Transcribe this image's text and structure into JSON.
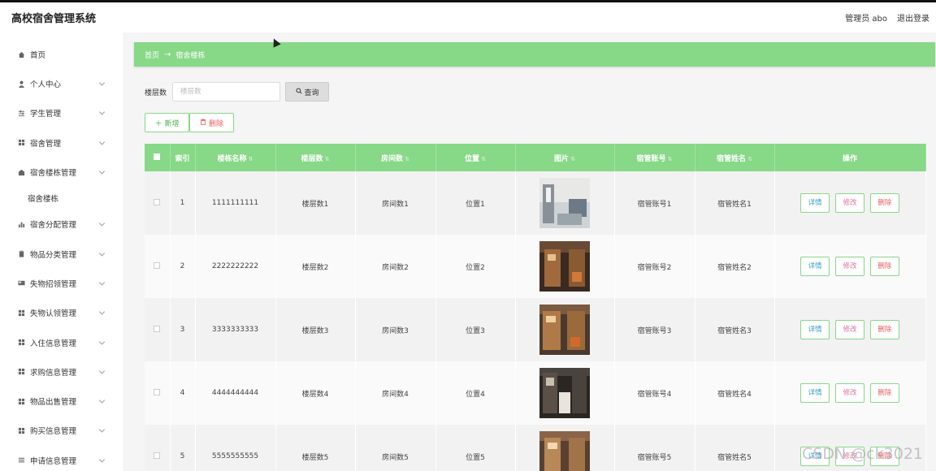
{
  "header": {
    "title": "高校宿舍管理系统",
    "user_label": "管理员 abo",
    "logout_label": "退出登录"
  },
  "sidebar": {
    "items": [
      {
        "label": "首页",
        "icon": "home-icon",
        "has_chevron": false
      },
      {
        "label": "个人中心",
        "icon": "user-icon",
        "has_chevron": true
      },
      {
        "label": "学生管理",
        "icon": "sliders-icon",
        "has_chevron": true
      },
      {
        "label": "宿舍管理",
        "icon": "grid-icon",
        "has_chevron": true
      },
      {
        "label": "宿舍楼栋管理",
        "icon": "building-icon",
        "has_chevron": true
      },
      {
        "label": "宿舍楼栋",
        "sub": true
      },
      {
        "label": "宿舍分配管理",
        "icon": "chart-icon",
        "has_chevron": true
      },
      {
        "label": "物品分类管理",
        "icon": "clipboard-icon",
        "has_chevron": true
      },
      {
        "label": "失物招领管理",
        "icon": "card-icon",
        "has_chevron": true
      },
      {
        "label": "失物认领管理",
        "icon": "grid-icon",
        "has_chevron": true
      },
      {
        "label": "入住信息管理",
        "icon": "grid-icon",
        "has_chevron": true
      },
      {
        "label": "求购信息管理",
        "icon": "grid-icon",
        "has_chevron": true
      },
      {
        "label": "物品出售管理",
        "icon": "grid-icon",
        "has_chevron": true
      },
      {
        "label": "购买信息管理",
        "icon": "grid-icon",
        "has_chevron": true
      },
      {
        "label": "申请信息管理",
        "icon": "list-icon",
        "has_chevron": true
      }
    ]
  },
  "breadcrumb": {
    "home": "首页",
    "arrow": "→",
    "current": "宿舍楼栋"
  },
  "search": {
    "label": "楼层数",
    "placeholder": "楼层数",
    "button_label": "查询"
  },
  "actions": {
    "add_label": "新增",
    "delete_label": "删除"
  },
  "table": {
    "columns": [
      "",
      "索引",
      "楼栋名称",
      "楼层数",
      "房间数",
      "位置",
      "图片",
      "宿管账号",
      "宿管姓名",
      "操作"
    ],
    "rows": [
      {
        "index": "1",
        "name": "1111111111",
        "floors": "楼层数1",
        "rooms": "房间数1",
        "location": "位置1",
        "account": "宿管账号1",
        "manager": "宿管姓名1"
      },
      {
        "index": "2",
        "name": "2222222222",
        "floors": "楼层数2",
        "rooms": "房间数2",
        "location": "位置2",
        "account": "宿管账号2",
        "manager": "宿管姓名2"
      },
      {
        "index": "3",
        "name": "3333333333",
        "floors": "楼层数3",
        "rooms": "房间数3",
        "location": "位置3",
        "account": "宿管账号3",
        "manager": "宿管姓名3"
      },
      {
        "index": "4",
        "name": "4444444444",
        "floors": "楼层数4",
        "rooms": "房间数4",
        "location": "位置4",
        "account": "宿管账号4",
        "manager": "宿管姓名4"
      },
      {
        "index": "5",
        "name": "5555555555",
        "floors": "楼层数5",
        "rooms": "房间数5",
        "location": "位置5",
        "account": "宿管账号5",
        "manager": "宿管姓名5"
      }
    ],
    "row_actions": {
      "detail": "详情",
      "edit": "修改",
      "delete": "删除"
    }
  },
  "watermark": "CSDN @ck3021",
  "colors": {
    "accent": "#87d887",
    "detail_text": "#3a9ec7",
    "edit_text": "#e0739c",
    "delete_text": "#e86060"
  }
}
